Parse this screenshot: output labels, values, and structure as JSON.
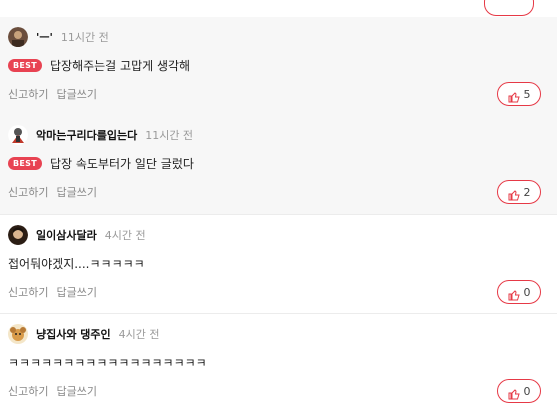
{
  "comments": [
    {
      "nickname": "'ㅡ'",
      "time": "11시간 전",
      "best_label": "BEST",
      "text": "답장해주는걸 고맙게 생각해",
      "report_label": "신고하기",
      "reply_label": "답글쓰기",
      "likes": "5",
      "avatar": "avatar-photo"
    },
    {
      "nickname": "악마는구리다를입는다",
      "time": "11시간 전",
      "best_label": "BEST",
      "text": "답장 속도부터가 일단 글렀다",
      "report_label": "신고하기",
      "reply_label": "답글쓰기",
      "likes": "2",
      "avatar": "avatar-character"
    },
    {
      "nickname": "일이삼사달라",
      "time": "4시간 전",
      "text": "접어둬야겠지....ㅋㅋㅋㅋㅋ",
      "report_label": "신고하기",
      "reply_label": "답글쓰기",
      "likes": "0",
      "avatar": "avatar-photo"
    },
    {
      "nickname": "냥집사와 댕주인",
      "time": "4시간 전",
      "text": "ㅋㅋㅋㅋㅋㅋㅋㅋㅋㅋㅋㅋㅋㅋㅋㅋㅋㅋ",
      "report_label": "신고하기",
      "reply_label": "답글쓰기",
      "likes": "0",
      "avatar": "avatar-pet"
    }
  ],
  "colors": {
    "accent": "#e63946",
    "best_badge": "#e84352",
    "best_bg": "#f7f7f7",
    "muted_text": "#888888"
  },
  "icons": {
    "like": "thumbs-up-icon"
  }
}
